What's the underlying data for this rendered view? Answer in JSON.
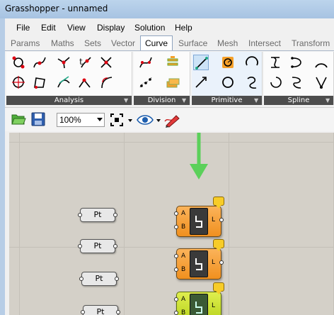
{
  "window": {
    "title": "Grasshopper - unnamed"
  },
  "menu": {
    "items": [
      "File",
      "Edit",
      "View",
      "Display",
      "Solution",
      "Help"
    ]
  },
  "tabs": {
    "items": [
      "Params",
      "Maths",
      "Sets",
      "Vector",
      "Curve",
      "Surface",
      "Mesh",
      "Intersect",
      "Transform"
    ],
    "active": "Curve"
  },
  "ribbon": {
    "panels": [
      {
        "label": "Analysis"
      },
      {
        "label": "Division"
      },
      {
        "label": "Primitive"
      },
      {
        "label": "Spline"
      }
    ]
  },
  "toolbar": {
    "zoom": "100%"
  },
  "canvas": {
    "pt_params": [
      "Pt",
      "Pt",
      "Pt",
      "Pt"
    ],
    "components": [
      {
        "inputs": [
          "A",
          "B"
        ],
        "output": "L",
        "color": "#f39a2a"
      },
      {
        "inputs": [
          "A",
          "B"
        ],
        "output": "L",
        "color": "#f39a2a"
      },
      {
        "inputs": [
          "A",
          "B"
        ],
        "output": "L",
        "color": "#c5dd28"
      }
    ]
  },
  "colors": {
    "accent_arrow": "#5bd05a",
    "titlebar": "#b7cde6",
    "canvas_bg": "#d4d0c8"
  }
}
